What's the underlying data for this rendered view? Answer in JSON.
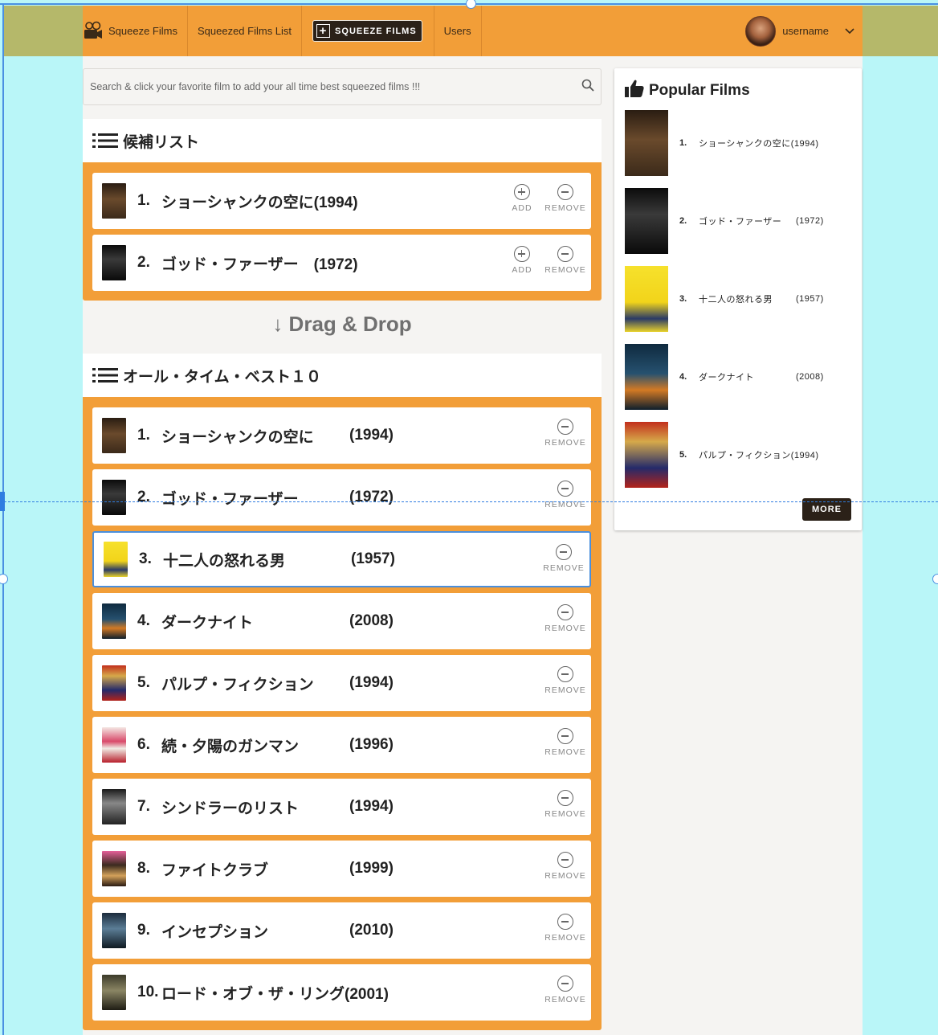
{
  "nav": {
    "brand_label": "Squeeze Films",
    "list_label": "Squeezed Films List",
    "squeeze_button_label": "SQUEEZE FILMS",
    "users_label": "Users",
    "username": "username"
  },
  "search": {
    "placeholder": "Search & click your favorite film to add your all time best squeezed films !!!"
  },
  "candidates": {
    "heading": "候補リスト",
    "add_label": "ADD",
    "remove_label": "REMOVE",
    "items": [
      {
        "rank": "1.",
        "title": "ショーシャンクの空に(1994)",
        "poster": "shawshank"
      },
      {
        "rank": "2.",
        "title": "ゴッド・ファーザー　(1972)",
        "poster": "godfather"
      }
    ]
  },
  "drag_drop_label": "↓ Drag & Drop",
  "best10": {
    "heading": "オール・タイム・ベスト１０",
    "remove_label": "REMOVE",
    "items": [
      {
        "rank": "1.",
        "title": "ショーシャンクの空に",
        "year": "(1994)",
        "poster": "shawshank"
      },
      {
        "rank": "2.",
        "title": "ゴッド・ファーザー",
        "year": "(1972)",
        "poster": "godfather"
      },
      {
        "rank": "3.",
        "title": "十二人の怒れる男",
        "year": "(1957)",
        "poster": "12-angry-men"
      },
      {
        "rank": "4.",
        "title": "ダークナイト",
        "year": "(2008)",
        "poster": "dark-knight"
      },
      {
        "rank": "5.",
        "title": "パルプ・フィクション",
        "year": "(1994)",
        "poster": "pulp-fiction"
      },
      {
        "rank": "6.",
        "title": "続・夕陽のガンマン",
        "year": "(1996)",
        "poster": "good-bad-ugly"
      },
      {
        "rank": "7.",
        "title": "シンドラーのリスト",
        "year": "(1994)",
        "poster": "schindler"
      },
      {
        "rank": "8.",
        "title": "ファイトクラブ",
        "year": "(1999)",
        "poster": "fight-club"
      },
      {
        "rank": "9.",
        "title": "インセプション",
        "year": "(2010)",
        "poster": "inception"
      },
      {
        "rank": "10.",
        "title": "ロード・オブ・ザ・リング(2001)",
        "year": "",
        "poster": "lotr"
      }
    ]
  },
  "popular": {
    "heading": "Popular Films",
    "more_label": "MORE",
    "items": [
      {
        "rank": "1.",
        "title": "ショーシャンクの空に(1994)",
        "year": "",
        "poster": "shawshank"
      },
      {
        "rank": "2.",
        "title": "ゴッド・ファーザー",
        "year": "(1972)",
        "poster": "godfather"
      },
      {
        "rank": "3.",
        "title": "十二人の怒れる男",
        "year": "(1957)",
        "poster": "12-angry-men"
      },
      {
        "rank": "4.",
        "title": "ダークナイト",
        "year": "(2008)",
        "poster": "dark-knight"
      },
      {
        "rank": "5.",
        "title": "パルプ・フィクション(1994)",
        "year": "",
        "poster": "pulp-fiction"
      }
    ]
  },
  "colors": {
    "accent": "#f29e38",
    "dark": "#2b2118",
    "background": "#b9f6f8",
    "focus": "#4a8fdd"
  }
}
